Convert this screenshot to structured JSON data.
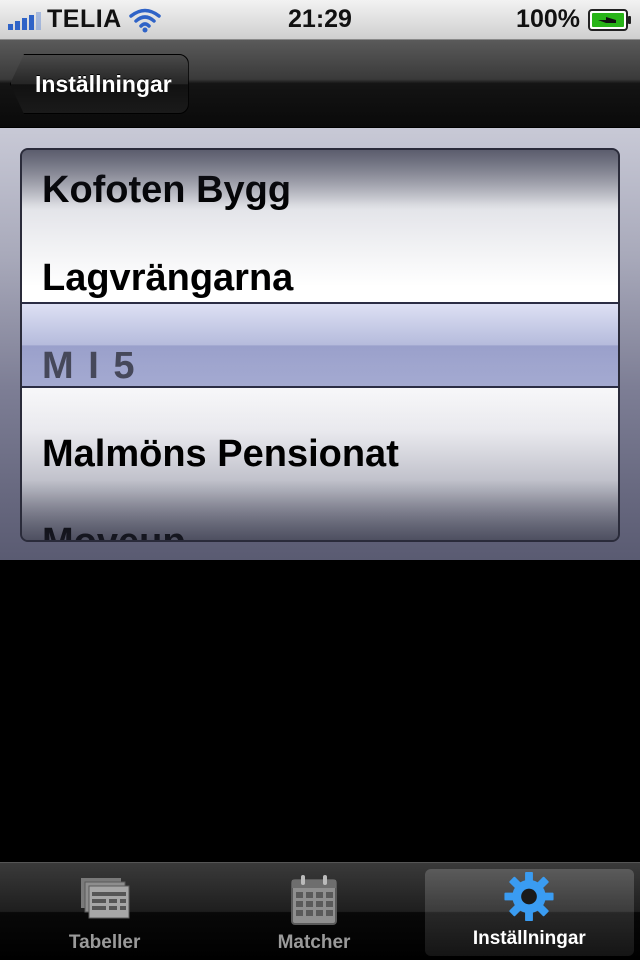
{
  "status_bar": {
    "carrier": "TELIA",
    "time": "21:29",
    "battery": "100%",
    "signal_icon": "signal-bars-icon",
    "wifi_icon": "wifi-icon",
    "battery_icon": "battery-charging-icon"
  },
  "nav": {
    "back_label": "Inställningar"
  },
  "picker": {
    "rows": [
      {
        "label": "Kofoten Bygg"
      },
      {
        "label": "Lagvrängarna"
      },
      {
        "label": "M I 5"
      },
      {
        "label": "Malmöns Pensionat"
      },
      {
        "label": "Moveup"
      }
    ],
    "selected_index": 2
  },
  "tab_bar": {
    "tabs": [
      {
        "label": "Tabeller",
        "icon": "tables-icon"
      },
      {
        "label": "Matcher",
        "icon": "calendar-icon"
      },
      {
        "label": "Inställningar",
        "icon": "gear-icon"
      }
    ],
    "active_index": 2
  },
  "colors": {
    "accent": "#2f63c7",
    "active_tab_icon": "#3a9cf2"
  }
}
